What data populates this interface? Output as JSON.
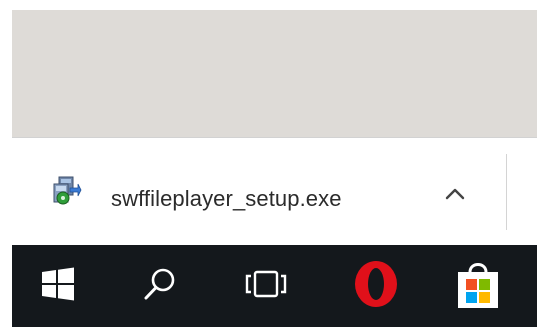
{
  "download_shelf": {
    "item": {
      "file_name": "swffileplayer_setup.exe",
      "file_icon": "installer-file-icon",
      "menu_icon": "chevron-up-icon"
    }
  },
  "taskbar": {
    "buttons": [
      {
        "icon": "windows-start-icon"
      },
      {
        "icon": "search-icon"
      },
      {
        "icon": "task-view-icon"
      },
      {
        "icon": "opera-browser-icon"
      },
      {
        "icon": "microsoft-store-icon"
      }
    ]
  },
  "colors": {
    "content_bg": "#dedbd7",
    "taskbar_bg": "#14181c",
    "opera_red": "#e0101a",
    "store_red": "#f25022",
    "store_green": "#7fba00",
    "store_blue": "#00a4ef",
    "store_yellow": "#ffb900"
  }
}
